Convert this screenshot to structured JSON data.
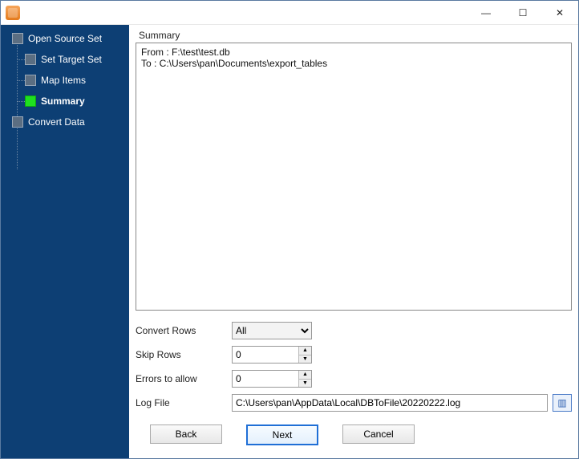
{
  "sidebar": {
    "items": [
      {
        "label": "Open Source Set"
      },
      {
        "label": "Set Target Set"
      },
      {
        "label": "Map Items"
      },
      {
        "label": "Summary"
      },
      {
        "label": "Convert Data"
      }
    ],
    "current_index": 3
  },
  "summary": {
    "heading": "Summary",
    "from_line": "From : F:\\test\\test.db",
    "to_line": "To : C:\\Users\\pan\\Documents\\export_tables"
  },
  "options": {
    "convert_rows_label": "Convert Rows",
    "convert_rows_value": "All",
    "skip_rows_label": "Skip Rows",
    "skip_rows_value": "0",
    "errors_label": "Errors to allow",
    "errors_value": "0",
    "log_file_label": "Log File",
    "log_file_value": "C:\\Users\\pan\\AppData\\Local\\DBToFile\\20220222.log"
  },
  "buttons": {
    "back": "Back",
    "next": "Next",
    "cancel": "Cancel"
  },
  "win": {
    "minimize": "—",
    "maximize": "☐",
    "close": "✕"
  },
  "icons": {
    "browse": "▥",
    "up": "▲",
    "down": "▼"
  }
}
